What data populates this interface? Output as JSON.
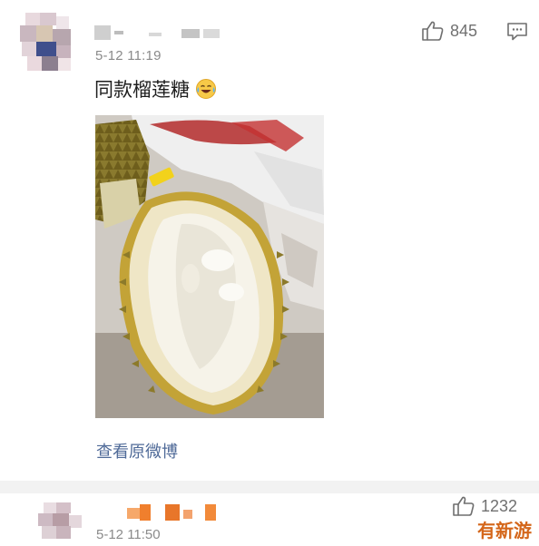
{
  "comment1": {
    "timestamp": "5-12 11:19",
    "text": "同款榴莲糖",
    "emoji": "laughing-crying-emoji",
    "likes": "845",
    "view_original_label": "查看原微博"
  },
  "comment2": {
    "timestamp": "5-12 11:50",
    "likes": "1232"
  },
  "watermark": "有新游",
  "colors": {
    "link": "#4f6a98",
    "meta_text": "#8a8a8a",
    "divider": "#f2f2f2",
    "watermark": "#d4661a"
  }
}
